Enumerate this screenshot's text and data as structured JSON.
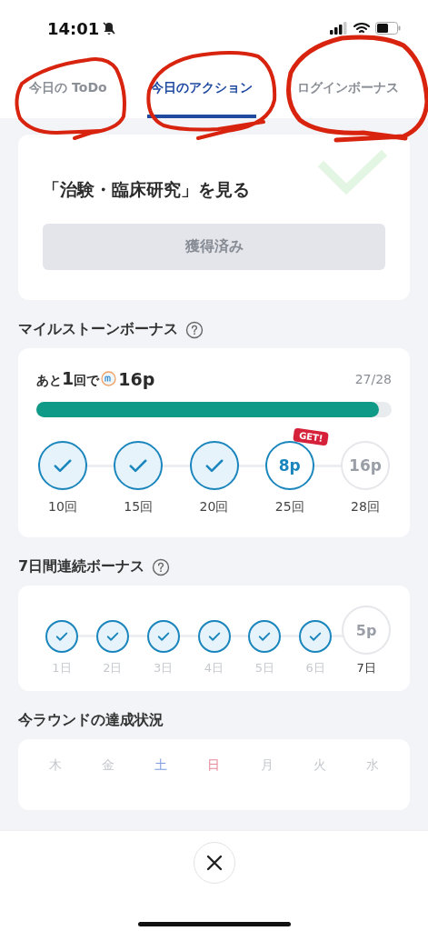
{
  "status_bar": {
    "time": "14:01"
  },
  "tabs": [
    {
      "label": "今日の ToDo",
      "selected": false
    },
    {
      "label": "今日のアクション",
      "selected": true
    },
    {
      "label": "ログインボーナス",
      "selected": false
    }
  ],
  "action_card": {
    "title": "「治験・臨床研究」を見る",
    "completed": true,
    "button": {
      "label": "獲得済み",
      "disabled": true
    }
  },
  "milestone": {
    "title": "マイルストーンボーナス",
    "remaining": "あと**1**回で",
    "reward": "16p",
    "count": "27/28",
    "level": 0.964,
    "steps": [
      {
        "label": "10回",
        "kind": "done"
      },
      {
        "label": "15回",
        "kind": "done"
      },
      {
        "label": "20回",
        "kind": "done"
      },
      {
        "label": "25回",
        "kind": "current",
        "value": "8p",
        "badge": "GET!"
      },
      {
        "label": "28回",
        "kind": "locked",
        "value": "16p"
      }
    ]
  },
  "streak": {
    "title": "7日間連続ボーナス",
    "days": [
      {
        "label": "1日",
        "kind": "done"
      },
      {
        "label": "2日",
        "kind": "done"
      },
      {
        "label": "3日",
        "kind": "done"
      },
      {
        "label": "4日",
        "kind": "done"
      },
      {
        "label": "5日",
        "kind": "done"
      },
      {
        "label": "6日",
        "kind": "done"
      },
      {
        "label": "7日",
        "kind": "reward",
        "value": "5p"
      }
    ]
  },
  "round": {
    "title": "今ラウンドの達成状況",
    "weekdays": [
      {
        "label": "木",
        "color": "#c4c7cc"
      },
      {
        "label": "金",
        "color": "#c4c7cc"
      },
      {
        "label": "土",
        "color": "#7f9be0"
      },
      {
        "label": "日",
        "color": "#e8899a"
      },
      {
        "label": "月",
        "color": "#c4c7cc"
      },
      {
        "label": "火",
        "color": "#c4c7cc"
      },
      {
        "label": "水",
        "color": "#c4c7cc"
      }
    ]
  }
}
